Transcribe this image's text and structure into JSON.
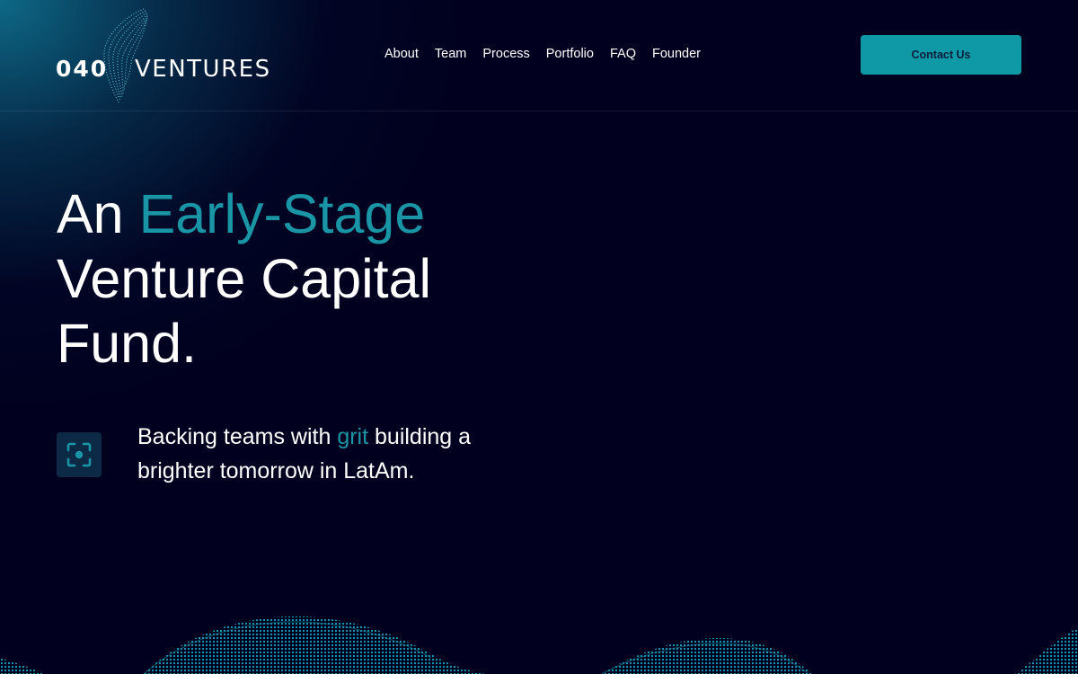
{
  "brand": {
    "number": "040",
    "name": "VENTURES"
  },
  "nav": {
    "items": [
      "About",
      "Team",
      "Process",
      "Portfolio",
      "FAQ",
      "Founder"
    ]
  },
  "header": {
    "cta_label": "Contact Us"
  },
  "hero": {
    "title_line1_plain": "An ",
    "title_line1_accent": "Early-Stage",
    "title_line2": "Venture Capital",
    "title_line3": "Fund.",
    "tagline_before": "Backing teams with ",
    "tagline_accent": "grit",
    "tagline_after": " building a brighter tomorrow in LatAm.",
    "tagline_icon": "focus-target-icon"
  },
  "colors": {
    "background": "#01011f",
    "accent": "#1a95a6",
    "cta_background": "#0f99a7"
  }
}
